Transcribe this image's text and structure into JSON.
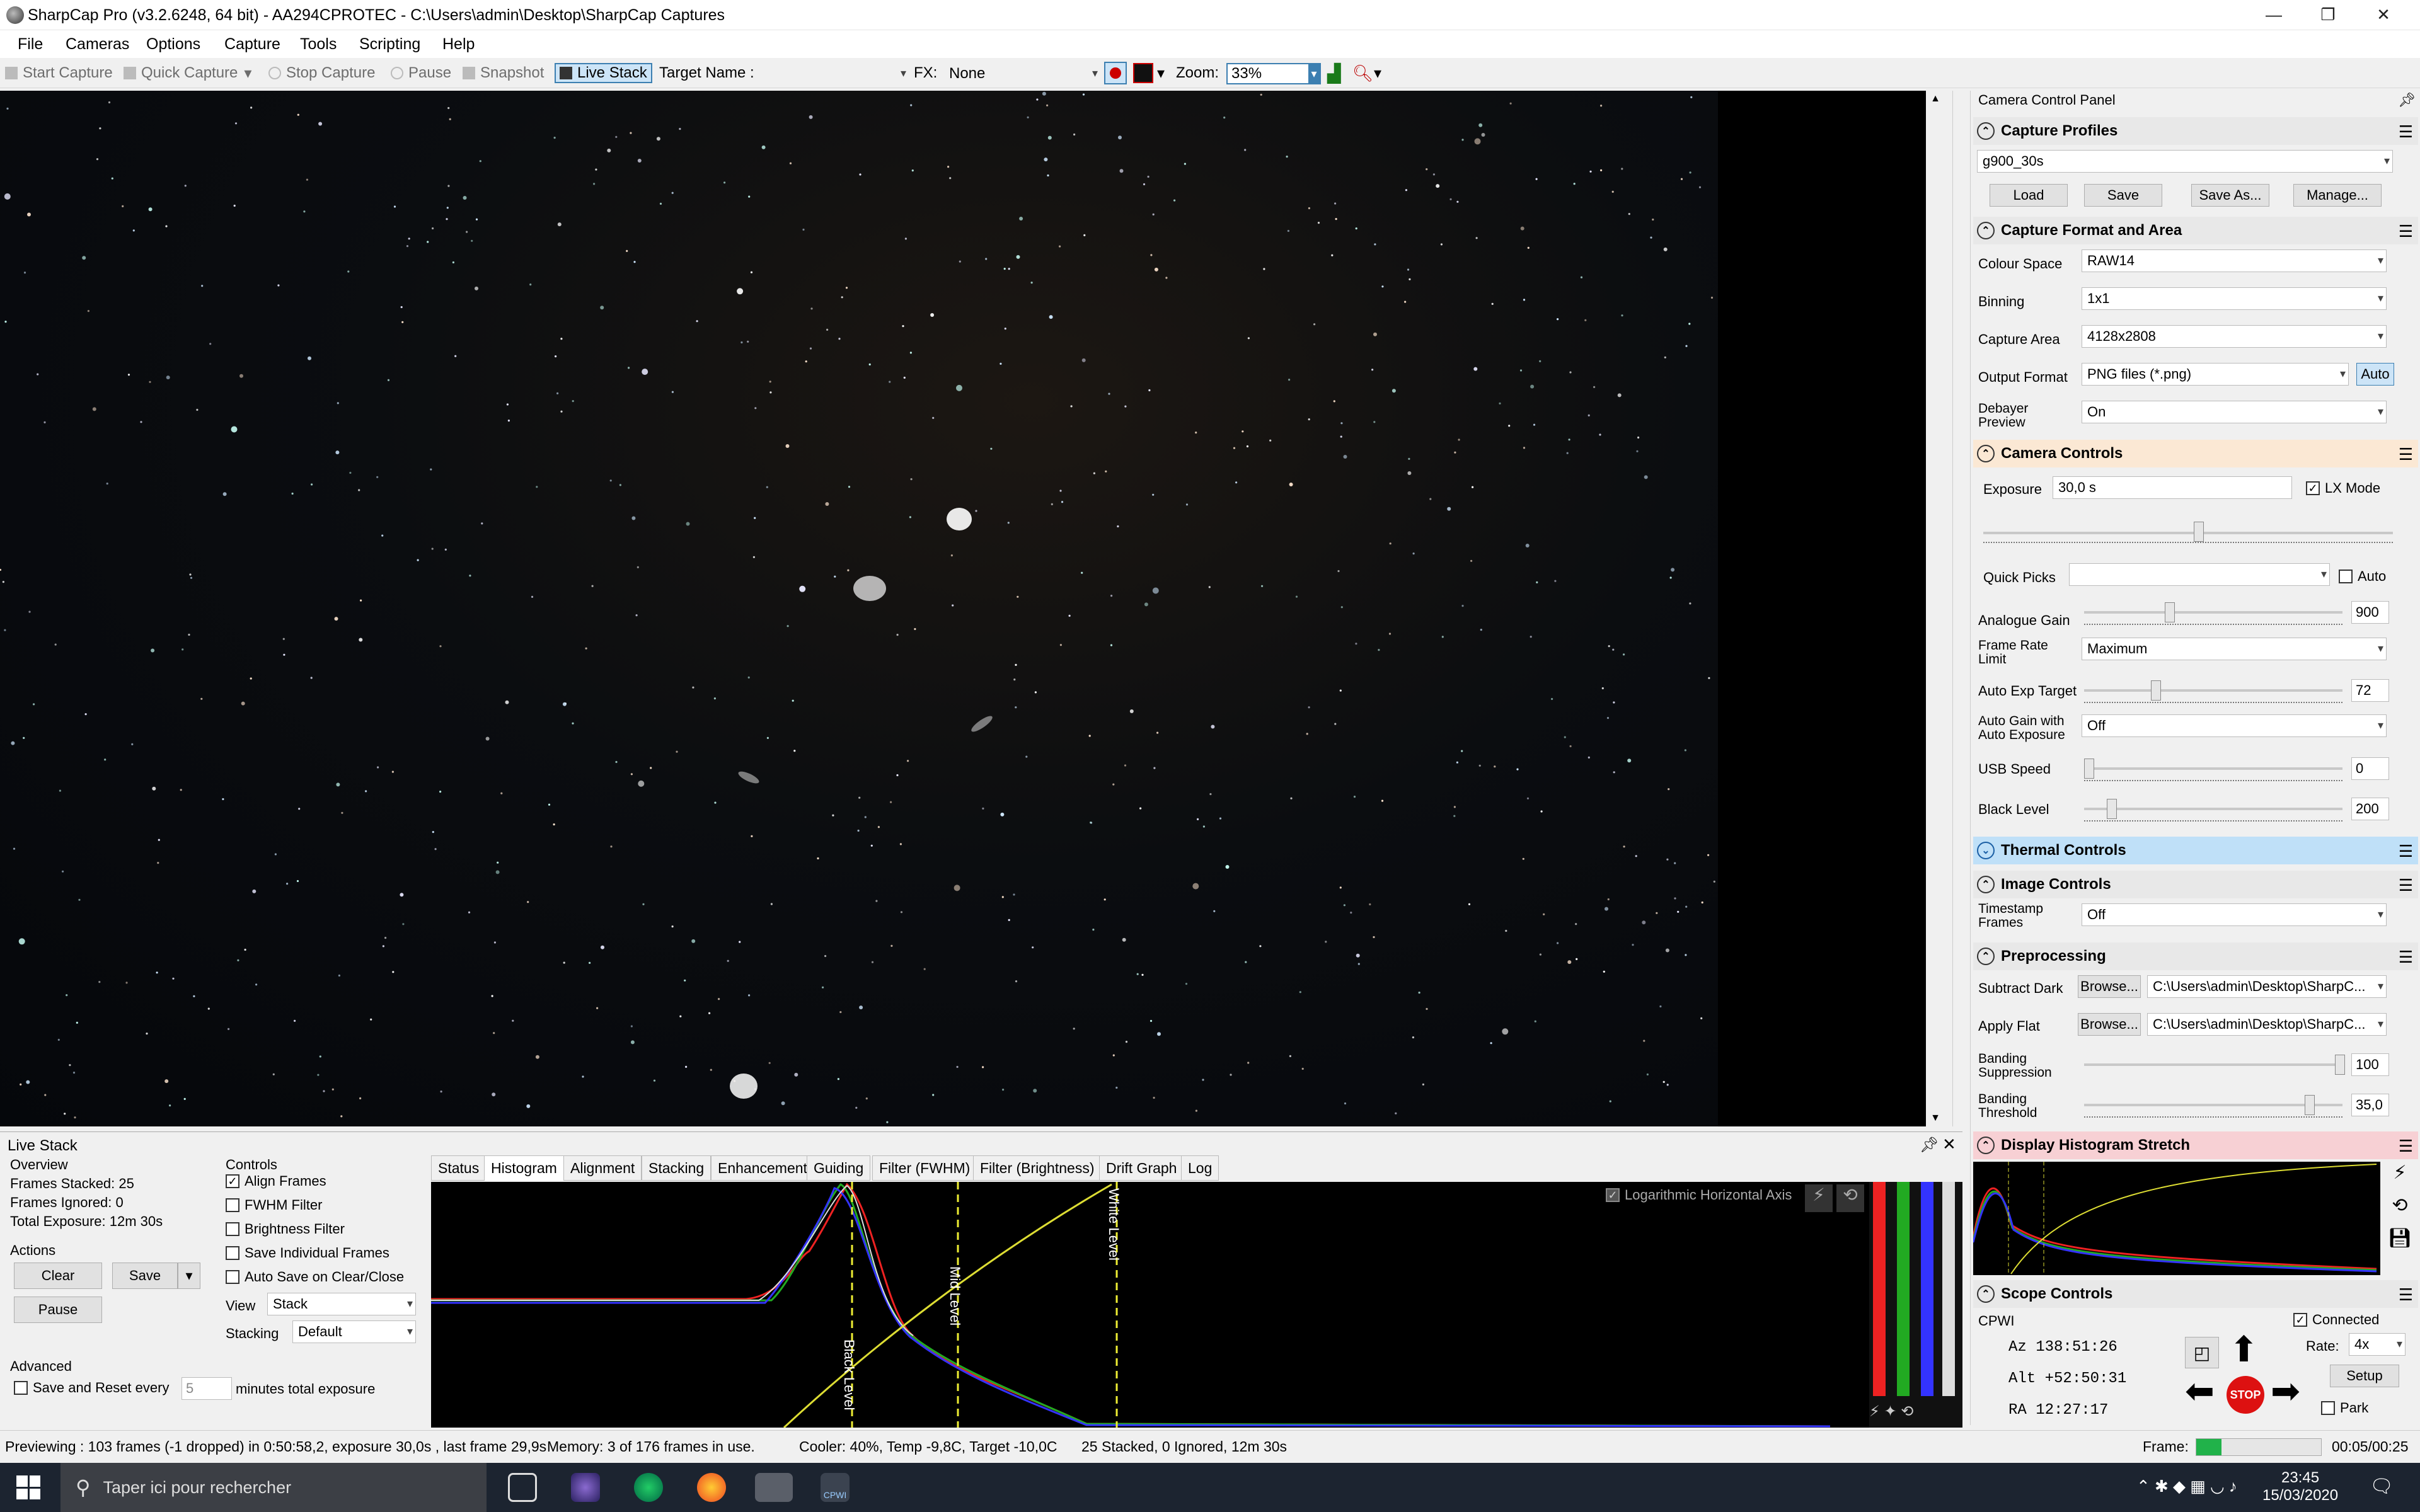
{
  "window": {
    "title": "SharpCap Pro (v3.2.6248, 64 bit) - AA294CPROTEC - C:\\Users\\admin\\Desktop\\SharpCap Captures",
    "min": "—",
    "max": "❐",
    "close": "✕"
  },
  "menu": [
    "File",
    "Cameras",
    "Options",
    "Capture",
    "Tools",
    "Scripting",
    "Help"
  ],
  "toolbar": {
    "start": "Start Capture",
    "quick": "Quick Capture",
    "stop": "Stop Capture",
    "pause": "Pause",
    "snapshot": "Snapshot",
    "livestack": "Live Stack",
    "target_label": "Target Name :",
    "fx_label": "FX:",
    "fx_value": "None",
    "zoom_label": "Zoom:",
    "zoom_value": "33%"
  },
  "panel": {
    "title": "Camera Control Panel",
    "capture_profiles": {
      "header": "Capture Profiles",
      "profile": "g900_30s",
      "load": "Load",
      "save": "Save",
      "save_as": "Save As...",
      "manage": "Manage..."
    },
    "format": {
      "header": "Capture Format and Area",
      "colour_space_label": "Colour Space",
      "colour_space": "RAW14",
      "binning_label": "Binning",
      "binning": "1x1",
      "area_label": "Capture Area",
      "area": "4128x2808",
      "output_label": "Output Format",
      "output": "PNG files (*.png)",
      "auto": "Auto",
      "debayer_label_1": "Debayer",
      "debayer_label_2": "Preview",
      "debayer": "On"
    },
    "camera": {
      "header": "Camera Controls",
      "exposure_label": "Exposure",
      "exposure": "30,0 s",
      "lx_mode": "LX Mode",
      "quick_picks": "Quick Picks",
      "auto": "Auto",
      "gain_label": "Analogue Gain",
      "gain": "900",
      "frl_label_1": "Frame Rate",
      "frl_label_2": "Limit",
      "frl": "Maximum",
      "aet_label": "Auto Exp Target",
      "aet": "72",
      "agae_label_1": "Auto Gain with",
      "agae_label_2": "Auto Exposure",
      "agae": "Off",
      "usb_label": "USB Speed",
      "usb": "0",
      "black_label": "Black Level",
      "black": "200"
    },
    "thermal": {
      "header": "Thermal Controls"
    },
    "image": {
      "header": "Image Controls",
      "ts_label_1": "Timestamp",
      "ts_label_2": "Frames",
      "ts": "Off"
    },
    "pre": {
      "header": "Preprocessing",
      "dark_label": "Subtract Dark",
      "flat_label": "Apply Flat",
      "browse": "Browse...",
      "dark_path": "C:\\Users\\admin\\Desktop\\SharpC...",
      "flat_path": "C:\\Users\\admin\\Desktop\\SharpC...",
      "bs_label_1": "Banding",
      "bs_label_2": "Suppression",
      "bs": "100",
      "bt_label_1": "Banding",
      "bt_label_2": "Threshold",
      "bt": "35,0"
    },
    "dhs": {
      "header": "Display Histogram Stretch"
    },
    "scope": {
      "header": "Scope Controls",
      "name": "CPWI",
      "connected": "Connected",
      "az": "Az  138:51:26",
      "alt": "Alt +52:50:31",
      "ra": "RA  12:27:17",
      "rate_label": "Rate:",
      "rate": "4x",
      "setup": "Setup",
      "park": "Park",
      "stop": "STOP"
    }
  },
  "livestack": {
    "title": "Live Stack",
    "overview": "Overview",
    "frames_stacked": "Frames Stacked:  25",
    "frames_ignored": "Frames Ignored:  0",
    "total_exposure": "Total Exposure:  12m 30s",
    "actions": "Actions",
    "clear": "Clear",
    "save": "Save",
    "pause": "Pause",
    "advanced": "Advanced",
    "save_reset": "Save and Reset every",
    "minutes_value": "5",
    "minutes_label": "minutes total exposure",
    "controls": "Controls",
    "align": "Align Frames",
    "fwhm": "FWHM Filter",
    "brightness": "Brightness Filter",
    "save_individual": "Save Individual Frames",
    "auto_save": "Auto Save on Clear/Close",
    "view_label": "View",
    "view": "Stack",
    "stacking_label": "Stacking",
    "stacking": "Default",
    "tabs": [
      "Status",
      "Histogram",
      "Alignment",
      "Stacking",
      "Enhancement",
      "Guiding",
      "Filter (FWHM)",
      "Filter (Brightness)",
      "Drift Graph",
      "Log"
    ],
    "log_axis": "Logarithmic Horizontal Axis",
    "black_level": "Black Level",
    "mid_level": "Mid Level",
    "white_level": "White Level"
  },
  "status": {
    "preview": "Previewing : 103 frames (-1 dropped) in 0:50:58,2, exposure 30,0s , last frame 29,9s",
    "memory": "Memory: 3 of 176 frames in use.",
    "cooler": "Cooler: 40%, Temp -9,8C, Target -10,0C",
    "stacked": "25 Stacked, 0 Ignored, 12m 30s",
    "frame_label": "Frame:",
    "elapsed": "00:05/00:25"
  },
  "taskbar": {
    "search": "Taper ici pour rechercher",
    "time": "23:45",
    "date": "15/03/2020",
    "cpwi": "CPWI"
  }
}
